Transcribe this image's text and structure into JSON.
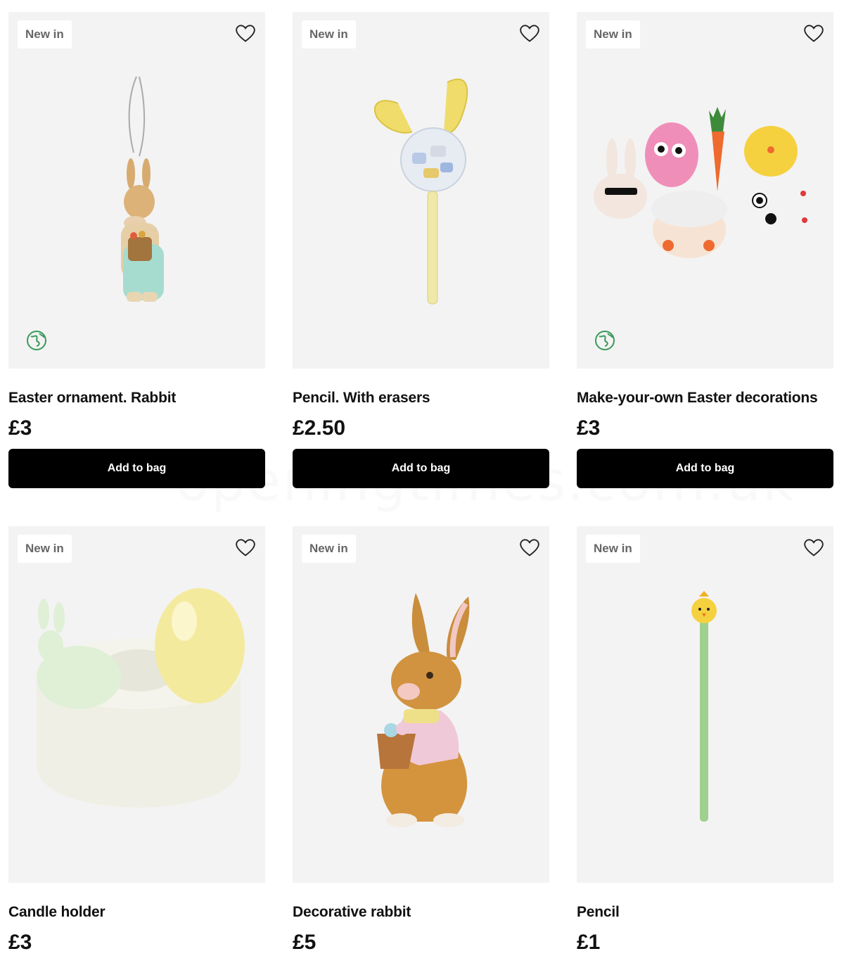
{
  "watermark": "openingtimes.com.uk",
  "products": [
    {
      "badge": "New in",
      "title": "Easter ornament. Rabbit",
      "price": "£3",
      "button": "Add to bag",
      "eco": true
    },
    {
      "badge": "New in",
      "title": "Pencil. With erasers",
      "price": "£2.50",
      "button": "Add to bag",
      "eco": false
    },
    {
      "badge": "New in",
      "title": "Make-your-own Easter decorations",
      "price": "£3",
      "button": "Add to bag",
      "eco": true
    },
    {
      "badge": "New in",
      "title": "Candle holder",
      "price": "£3"
    },
    {
      "badge": "New in",
      "title": "Decorative rabbit",
      "price": "£5"
    },
    {
      "badge": "New in",
      "title": "Pencil",
      "price": "£1"
    }
  ],
  "icons": {
    "favorite": "heart-outline-icon",
    "eco": "globe-leaf-icon"
  },
  "colors": {
    "button_bg": "#000000",
    "card_bg": "#f3f3f3",
    "eco_green": "#3a9a5b"
  }
}
